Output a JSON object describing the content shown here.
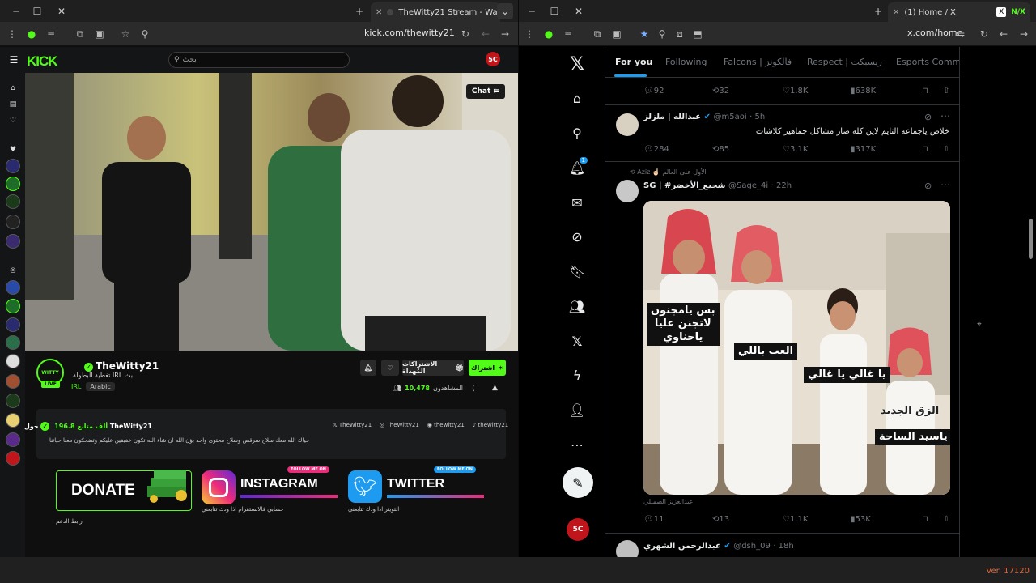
{
  "left": {
    "tab_title": "TheWitty21 Stream - Watch",
    "url": "kick.com/thewitty21",
    "search_placeholder": "بحث",
    "video_chat_label": "Chat",
    "channel_name": "TheWitty21",
    "stream_title": "تغطية البطولة IRL بث",
    "category": "IRL",
    "language_tag": "Arabic",
    "follow_label": "اشتراك",
    "gift_subs_label": "الاشتراكات المُهداة",
    "viewers_label": "المشاهدون",
    "viewers_count": "10,478",
    "about_title": "حول TheWitty21",
    "followers_count": "196.8",
    "followers_unit": "ألف متابع",
    "socials": [
      "TheWitty21",
      "TheWitty21",
      "thewitty21",
      "thewitty21"
    ],
    "about_text": "حياك الله معك سلاح سرقص وسلاح محتوى واحد بؤن الله ان شاء الله تكون خفيفين عليكم وتضحكون معنا حياتنا",
    "donate_label": "DONATE",
    "instagram_label": "INSTAGRAM",
    "twitter_label": "TWITTER",
    "follow_me_on": "FOLLOW ME ON",
    "donate_caption": "رابط الدعم",
    "instagram_caption": "حسابي فالانستقرام اذا ودك تتابعني",
    "twitter_caption": "التويتر اذا ودك تتابعني"
  },
  "right": {
    "tab_title": "(1) Home / X",
    "url": "x.com/home",
    "tabs": [
      "For you",
      "Following",
      "Falcons | فالكونز",
      "Respect | ريسبكت",
      "Esports Commu"
    ],
    "notif_count": "1",
    "post0": {
      "replies": "92",
      "reposts": "32",
      "likes": "1.8K",
      "views": "638K"
    },
    "post1": {
      "name": "عبدالله | ملزلز",
      "handle": "@m5aoi",
      "time": "· 5h",
      "text": "خلاص ياجماعة التايم لاين كله صار مشاكل جماهير كلاشات",
      "replies": "284",
      "reposts": "85",
      "likes": "3.1K",
      "views": "317K"
    },
    "post2": {
      "reposted_by": "Aziz ☝🏻 الأول على العالم",
      "name": "SG | #شجيع_الأخضر",
      "handle": "@Sage_4i",
      "time": "· 22h",
      "captions": [
        "بس يامجنون",
        "لاتجنن عليا",
        "ياحناوي",
        "العب باللي",
        "يا غالي يا غالي",
        "الزق الجديد",
        "ياسيد الساحة"
      ],
      "watermark": "عبدالعزيز الصميلي",
      "replies": "11",
      "reposts": "13",
      "likes": "1.1K",
      "views": "53K"
    },
    "post3": {
      "name": "عبدالرحمن الشهري",
      "handle": "@dsh_09",
      "time": "· 18h"
    }
  },
  "taskbar": {
    "version": "Ver. 17120"
  },
  "colors": {
    "kick_green": "#53fc18",
    "x_blue": "#1d9bf0"
  }
}
